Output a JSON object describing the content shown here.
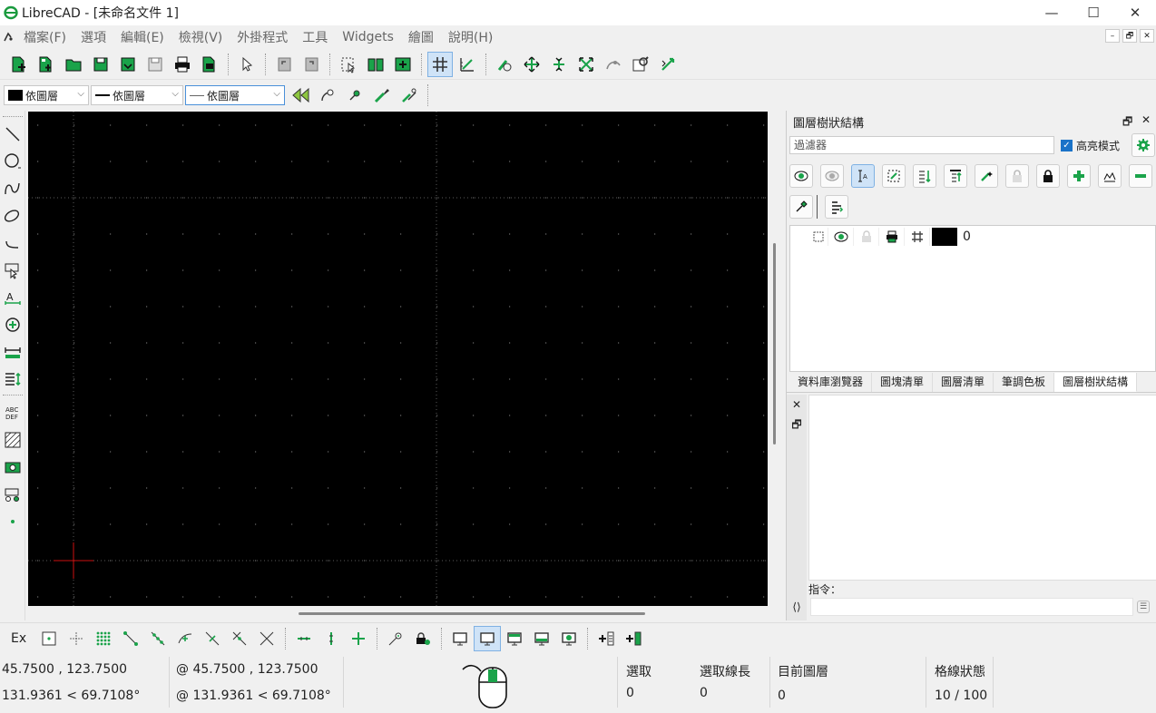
{
  "window": {
    "title": "LibreCAD - [未命名文件 1]",
    "controls": [
      "—",
      "☐",
      "✕"
    ]
  },
  "menu": {
    "items": [
      "檔案(F)",
      "選項",
      "編輯(E)",
      "檢視(V)",
      "外掛程式",
      "工具",
      "Widgets",
      "繪圖",
      "說明(H)"
    ]
  },
  "pen_toolbar": {
    "color": "依圖層",
    "width": "依圖層",
    "linetype": "依圖層"
  },
  "layer_dock": {
    "title": "圖層樹狀結構",
    "float_icon": "🗗",
    "close_icon": "✕",
    "filter_placeholder": "過濾器",
    "highlight_label": "高亮模式",
    "layers": [
      {
        "name": "0",
        "color": "#000000"
      }
    ]
  },
  "dock_tabs": [
    "資料庫瀏覽器",
    "圖塊清單",
    "圖層清單",
    "筆調色板",
    "圖層樹狀結構"
  ],
  "command": {
    "label": "指令："
  },
  "snap": {
    "ex_label": "Ex"
  },
  "status": {
    "abs_coord": "45.7500 , 123.7500",
    "abs_polar": "131.9361 < 69.7108°",
    "rel_coord": "@  45.7500 , 123.7500",
    "rel_polar": "@  131.9361 < 69.7108°",
    "selected_label": "選取",
    "selected_value": "0",
    "sel_length_label": "選取線長",
    "sel_length_value": "0",
    "current_layer_label": "目前圖層",
    "current_layer_value": "0",
    "grid_label": "格線狀態",
    "grid_value": "10 / 100"
  },
  "colors": {
    "accent": "#1aa34a",
    "canvas": "#000000",
    "crosshair": "#cc1111"
  }
}
